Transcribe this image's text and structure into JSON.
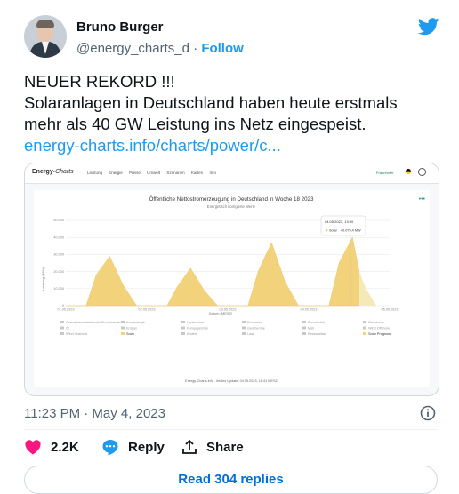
{
  "author": {
    "name": "Bruno Burger",
    "handle": "@energy_charts_d",
    "separator": " · ",
    "follow_label": "Follow"
  },
  "tweet": {
    "line1": "NEUER REKORD !!!",
    "line2": "Solaranlagen in Deutschland haben heute erstmals",
    "line3": "mehr als 40 GW Leistung ins Netz eingespeist.",
    "link": "energy-charts.info/charts/power/c..."
  },
  "card": {
    "logo_main": "Energy-",
    "logo_italic": "Charts",
    "nav": [
      "Leistung",
      "Energie",
      "Preise",
      "Umwelt",
      "Szenarien",
      "Karten",
      "Info"
    ],
    "fraunhofer": "Fraunhofer",
    "chart_title": "Öffentliche Nettostromerzeugung in Deutschland in Woche 18 2023",
    "chart_subtitle": "Energetisch korrigierte Werte",
    "ylabel": "Leistung (MW)",
    "xlabel": "Datum (MESZ)",
    "tooltip_date": "04.05.2023, 13:00",
    "tooltip_series": "Solar",
    "tooltip_value": "40.079,4 MW",
    "footer": "Energy-Charts.info - letztes Update: 04.05.2023, 18:41 MESZ",
    "legend": [
      "Grenzüberschreitender Stromhandel",
      "Kernenergie",
      "Laufwasser",
      "Biomasse",
      "Braunkohle",
      "Steinkohle",
      "Öl",
      "Erdgas",
      "Pumpspeicher",
      "Geothermie",
      "Müll",
      "Wind Offshore",
      "Wind Onshore",
      "Solar",
      "Andere",
      "Last",
      "Residuallast",
      "Solar Prognose"
    ]
  },
  "chart_data": {
    "type": "area",
    "title": "Öffentliche Nettostromerzeugung in Deutschland in Woche 18 2023",
    "subtitle": "Energetisch korrigierte Werte",
    "xlabel": "Datum (MESZ)",
    "ylabel": "Leistung (MW)",
    "x_ticks": [
      "01.05.2023",
      "02.05.2023",
      "03.05.2023",
      "04.05.2023",
      "05.05.2023"
    ],
    "y_ticks": [
      0,
      10000,
      20000,
      30000,
      40000,
      50000
    ],
    "ylim": [
      0,
      50000
    ],
    "series": [
      {
        "name": "Solar",
        "color": "#f2d27a",
        "x": [
          "01.05.2023 00:00",
          "01.05.2023 06:00",
          "01.05.2023 09:00",
          "01.05.2023 13:00",
          "01.05.2023 17:00",
          "01.05.2023 21:00",
          "02.05.2023 06:00",
          "02.05.2023 09:00",
          "02.05.2023 13:00",
          "02.05.2023 17:00",
          "02.05.2023 21:00",
          "03.05.2023 06:00",
          "03.05.2023 09:00",
          "03.05.2023 13:00",
          "03.05.2023 17:00",
          "03.05.2023 21:00",
          "04.05.2023 06:00",
          "04.05.2023 09:00",
          "04.05.2023 13:00",
          "04.05.2023 15:00"
        ],
        "values": [
          0,
          0,
          18000,
          29000,
          12000,
          0,
          0,
          11000,
          22000,
          9000,
          0,
          0,
          20000,
          37000,
          14000,
          0,
          0,
          25000,
          40079,
          20000
        ]
      },
      {
        "name": "Solar Prognose",
        "color": "#f6e9b8",
        "x": [
          "04.05.2023 15:00",
          "04.05.2023 17:00",
          "04.05.2023 20:00"
        ],
        "values": [
          20000,
          10000,
          0
        ]
      }
    ],
    "grid": true,
    "legend": "bottom"
  },
  "footer": {
    "time": "11:23 PM · May 4, 2023",
    "likes": "2.2K",
    "reply_label": "Reply",
    "share_label": "Share",
    "read_replies": "Read 304 replies"
  },
  "colors": {
    "accent": "#1d9bf0",
    "like": "#f91880",
    "solar": "#f2d27a"
  }
}
